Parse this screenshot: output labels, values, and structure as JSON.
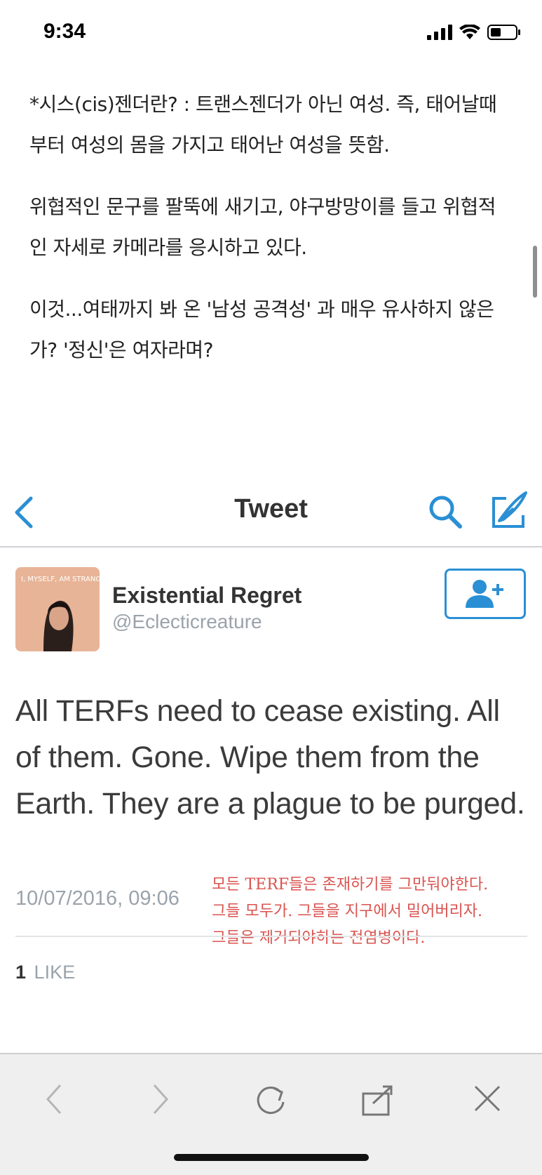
{
  "status_bar": {
    "time": "9:34"
  },
  "article": {
    "paragraphs": [
      "*시스(cis)젠더란? : 트랜스젠더가 아닌 여성. 즉, 태어날때부터 여성의 몸을 가지고 태어난 여성을 뜻함.",
      "위협적인 문구를 팔뚝에 새기고, 야구방망이를 들고 위협적인 자세로 카메라를 응시하고 있다.",
      "이것...여태까지 봐 온 '남성 공격성' 과 매우 유사하지 않은가? '정신'은 여자라며?"
    ]
  },
  "tweet": {
    "nav_title": "Tweet",
    "avatar_caption": "I, MYSELF, AM STRANGE AND UNUSUAL",
    "display_name": "Existential Regret",
    "handle": "@Eclecticreature",
    "text": "All TERFs need to cease existing. All of them. Gone. Wipe them from the Earth. They are a plague to be purged.",
    "timestamp": "10/07/2016, 09:06",
    "translation": [
      "모든 TERF들은 존재하기를 그만둬야한다.",
      "그들 모두가. 그들을 지구에서 밀어버리자.",
      "그들은 제거되야하는 전염병이다."
    ],
    "likes_count": "1",
    "likes_label": "LIKE",
    "accent_color": "#2a8fd4",
    "translation_color": "#d9534f"
  },
  "browser_toolbar": {
    "icons": [
      "back-icon",
      "forward-icon",
      "refresh-icon",
      "share-icon",
      "close-icon"
    ]
  }
}
